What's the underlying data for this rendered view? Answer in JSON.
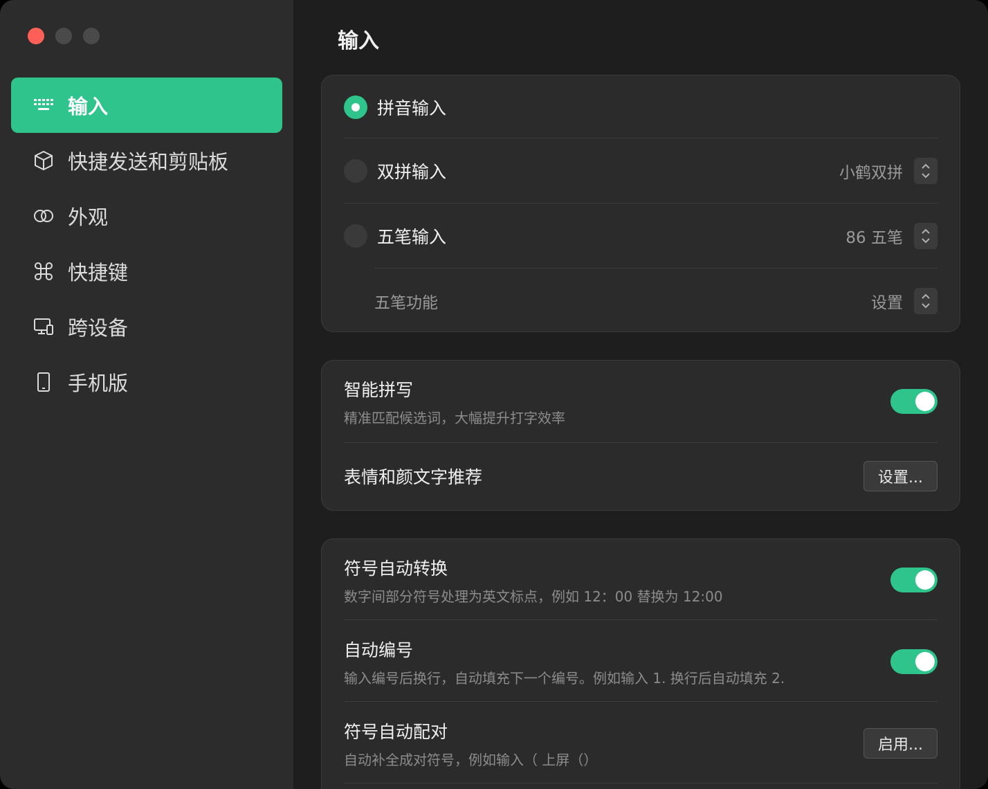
{
  "sidebar": {
    "items": [
      {
        "label": "输入",
        "icon": "keyboard-icon",
        "active": true
      },
      {
        "label": "快捷发送和剪贴板",
        "icon": "cube-icon",
        "active": false
      },
      {
        "label": "外观",
        "icon": "rings-icon",
        "active": false
      },
      {
        "label": "快捷键",
        "icon": "command-icon",
        "active": false
      },
      {
        "label": "跨设备",
        "icon": "devices-icon",
        "active": false
      },
      {
        "label": "手机版",
        "icon": "phone-icon",
        "active": false
      }
    ]
  },
  "main": {
    "title": "输入",
    "input_methods": {
      "pinyin": {
        "label": "拼音输入",
        "selected": true
      },
      "shuangpin": {
        "label": "双拼输入",
        "value": "小鹤双拼",
        "selected": false
      },
      "wubi": {
        "label": "五笔输入",
        "value": "86 五笔",
        "selected": false
      },
      "wubi_feature": {
        "label": "五笔功能",
        "value": "设置"
      }
    },
    "smart": {
      "smart_spell": {
        "label": "智能拼写",
        "desc": "精准匹配候选词，大幅提升打字效率",
        "enabled": true
      },
      "emoji": {
        "label": "表情和颜文字推荐",
        "button": "设置..."
      }
    },
    "symbols": {
      "auto_convert": {
        "label": "符号自动转换",
        "desc": "数字间部分符号处理为英文标点，例如 12：00 替换为 12:00",
        "enabled": true
      },
      "auto_number": {
        "label": "自动编号",
        "desc": "输入编号后换行，自动填充下一个编号。例如输入 1. 换行后自动填充 2.",
        "enabled": true
      },
      "auto_pair": {
        "label": "符号自动配对",
        "desc": "自动补全成对符号，例如输入（ 上屏（）",
        "button": "启用..."
      }
    }
  },
  "colors": {
    "accent": "#2fc48b",
    "close": "#fe5f57"
  }
}
